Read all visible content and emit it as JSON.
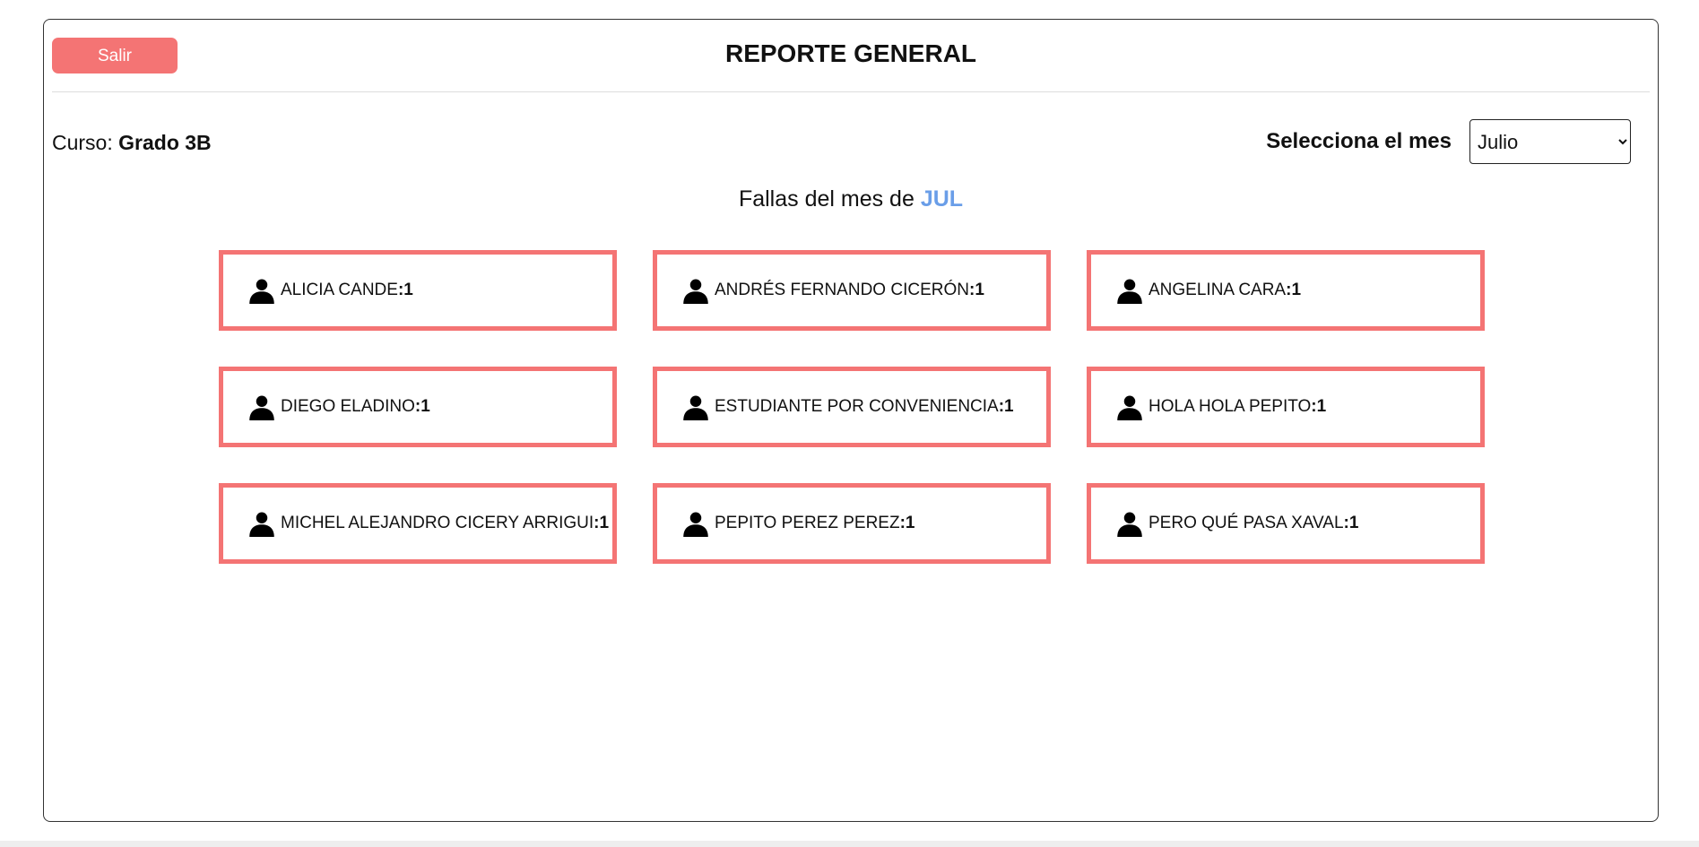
{
  "header": {
    "exit_label": "Salir",
    "title": "REPORTE GENERAL"
  },
  "course": {
    "label": "Curso: ",
    "value": "Grado 3B"
  },
  "month_select": {
    "label": "Selecciona el mes",
    "selected": "Julio"
  },
  "subtitle": {
    "prefix": "Fallas del mes de ",
    "month": "JUL"
  },
  "students": [
    {
      "name": "ALICIA CANDE",
      "absences": "1"
    },
    {
      "name": "ANDRÉS FERNANDO CICERÓN",
      "absences": "1"
    },
    {
      "name": "ANGELINA CARA",
      "absences": "1"
    },
    {
      "name": "DIEGO ELADINO",
      "absences": "1"
    },
    {
      "name": "ESTUDIANTE POR CONVENIENCIA",
      "absences": "1"
    },
    {
      "name": "HOLA HOLA PEPITO",
      "absences": "1"
    },
    {
      "name": "MICHEL ALEJANDRO CICERY ARRIGUI",
      "absences": "1"
    },
    {
      "name": "PEPITO PEREZ PEREZ",
      "absences": "1"
    },
    {
      "name": "PERO QUÉ PASA XAVAL",
      "absences": "1"
    }
  ],
  "colors": {
    "accent": "#f47474",
    "month_highlight": "#6a9ee8",
    "border": "#333333"
  },
  "icons": {
    "student": "person-icon",
    "select": "chevron-down-icon"
  }
}
